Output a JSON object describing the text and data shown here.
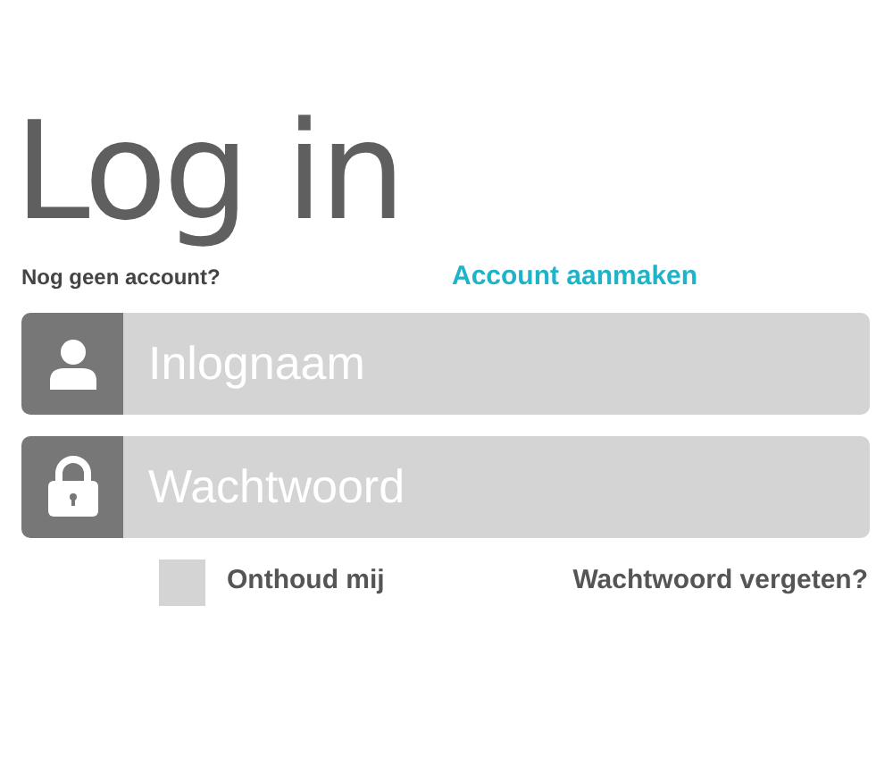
{
  "title": "Log in",
  "signup": {
    "prompt": "Nog geen account?",
    "link": "Account aanmaken"
  },
  "fields": [
    {
      "kind": "user",
      "placeholder": "Inlognaam"
    },
    {
      "kind": "lock",
      "placeholder": "Wachtwoord"
    }
  ],
  "remember": {
    "label": "Onthoud mij",
    "checked": false
  },
  "forgot": "Wachtwoord vergeten?"
}
